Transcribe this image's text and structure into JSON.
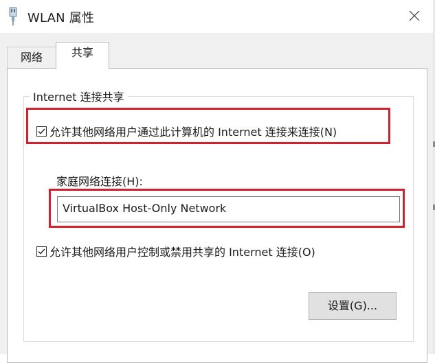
{
  "window": {
    "title": "WLAN 属性",
    "title_icon": "network-adapter-icon",
    "close_icon": "close-icon"
  },
  "tabs": [
    {
      "label": "网络",
      "selected": false
    },
    {
      "label": "共享",
      "selected": true
    }
  ],
  "sharing": {
    "group_title": "Internet 连接共享",
    "allow_sharing": {
      "label": "允许其他网络用户通过此计算机的 Internet 连接来连接(N)",
      "checked": true
    },
    "home_network": {
      "label": "家庭网络连接(H):",
      "value": "VirtualBox Host-Only Network"
    },
    "allow_control": {
      "label": "允许其他网络用户控制或禁用共享的 Internet 连接(O)",
      "checked": true
    },
    "settings_button": "设置(G)..."
  },
  "colors": {
    "highlight_border": "#d2202f",
    "dialog_background": "#f0f0f0",
    "panel_background": "#ffffff"
  }
}
